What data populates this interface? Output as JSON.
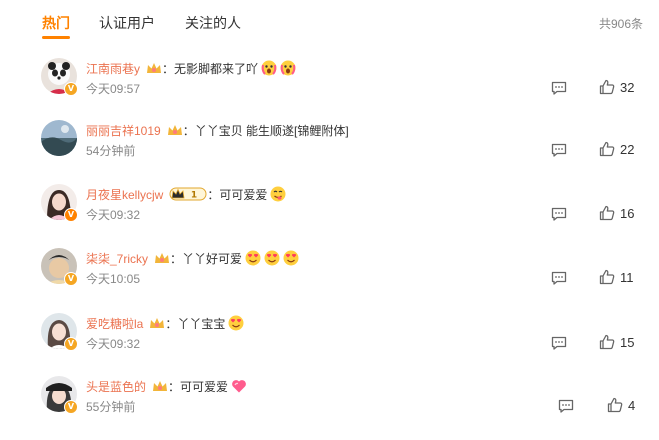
{
  "tabs": [
    {
      "label": "热门",
      "active": true
    },
    {
      "label": "认证用户",
      "active": false
    },
    {
      "label": "关注的人",
      "active": false
    }
  ],
  "total_count": "共906条",
  "colors": {
    "accent": "#ff8200",
    "username": "#eb7350",
    "muted": "#888888"
  },
  "comments": [
    {
      "user": "江南雨巷y",
      "text": "：无影脚都来了吖",
      "time": "今天09:57",
      "likes": "32",
      "emoji": [
        "scream-emoji",
        "scream-emoji"
      ]
    },
    {
      "user": "丽丽吉祥1019",
      "text": "：丫丫宝贝 能生顺遂[锦鲤附体]",
      "time": "54分钟前",
      "likes": "22",
      "emoji": []
    },
    {
      "user": "月夜星kellycjw",
      "text": "：可可爱爱",
      "time": "今天09:32",
      "likes": "16",
      "emoji": [
        "yummy-emoji"
      ],
      "crown_level": "1"
    },
    {
      "user": "柒柒_7ricky",
      "text": "：丫丫好可爱",
      "time": "今天10:05",
      "likes": "11",
      "emoji": [
        "heart-eyes-emoji",
        "heart-eyes-emoji",
        "heart-eyes-emoji"
      ]
    },
    {
      "user": "爱吃糖啦la",
      "text": "：丫丫宝宝",
      "time": "今天09:32",
      "likes": "15",
      "emoji": [
        "heart-eyes-emoji"
      ]
    },
    {
      "user": "头是蓝色的",
      "text": "：可可爱爱",
      "time": "55分钟前",
      "likes": "4",
      "emoji": [
        "heart-emoji"
      ]
    }
  ]
}
